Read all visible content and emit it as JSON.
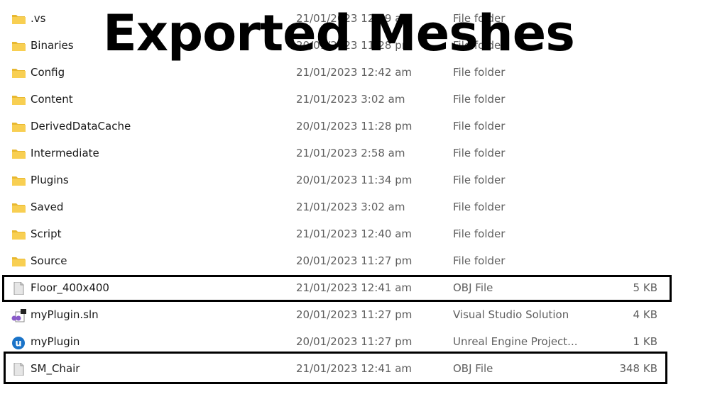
{
  "overlay_title": "Exported Meshes",
  "files": [
    {
      "name": ".vs",
      "date": "21/01/2023 12:19 am",
      "type": "File folder",
      "size": "",
      "icon": "folder-icon"
    },
    {
      "name": "Binaries",
      "date": "20/01/2023 11:28 pm",
      "type": "File folder",
      "size": "",
      "icon": "folder-icon"
    },
    {
      "name": "Config",
      "date": "21/01/2023 12:42 am",
      "type": "File folder",
      "size": "",
      "icon": "folder-icon"
    },
    {
      "name": "Content",
      "date": "21/01/2023 3:02 am",
      "type": "File folder",
      "size": "",
      "icon": "folder-icon"
    },
    {
      "name": "DerivedDataCache",
      "date": "20/01/2023 11:28 pm",
      "type": "File folder",
      "size": "",
      "icon": "folder-icon"
    },
    {
      "name": "Intermediate",
      "date": "21/01/2023 2:58 am",
      "type": "File folder",
      "size": "",
      "icon": "folder-icon"
    },
    {
      "name": "Plugins",
      "date": "20/01/2023 11:34 pm",
      "type": "File folder",
      "size": "",
      "icon": "folder-icon"
    },
    {
      "name": "Saved",
      "date": "21/01/2023 3:02 am",
      "type": "File folder",
      "size": "",
      "icon": "folder-icon"
    },
    {
      "name": "Script",
      "date": "21/01/2023 12:40 am",
      "type": "File folder",
      "size": "",
      "icon": "folder-icon"
    },
    {
      "name": "Source",
      "date": "20/01/2023 11:27 pm",
      "type": "File folder",
      "size": "",
      "icon": "folder-icon"
    },
    {
      "name": "Floor_400x400",
      "date": "21/01/2023 12:41 am",
      "type": "OBJ File",
      "size": "5 KB",
      "icon": "file-icon",
      "highlighted": true
    },
    {
      "name": "myPlugin.sln",
      "date": "20/01/2023 11:27 pm",
      "type": "Visual Studio Solution",
      "size": "4 KB",
      "icon": "visual-studio-icon"
    },
    {
      "name": "myPlugin",
      "date": "20/01/2023 11:27 pm",
      "type": "Unreal Engine Project...",
      "size": "1 KB",
      "icon": "unreal-engine-icon"
    },
    {
      "name": "SM_Chair",
      "date": "21/01/2023 12:41 am",
      "type": "OBJ File",
      "size": "348 KB",
      "icon": "file-icon",
      "highlighted": true
    }
  ],
  "colors": {
    "folder": "#f5c842",
    "highlight_border": "#000000",
    "unreal": "#1a73c8",
    "visual_studio": "#8a5cc9"
  }
}
